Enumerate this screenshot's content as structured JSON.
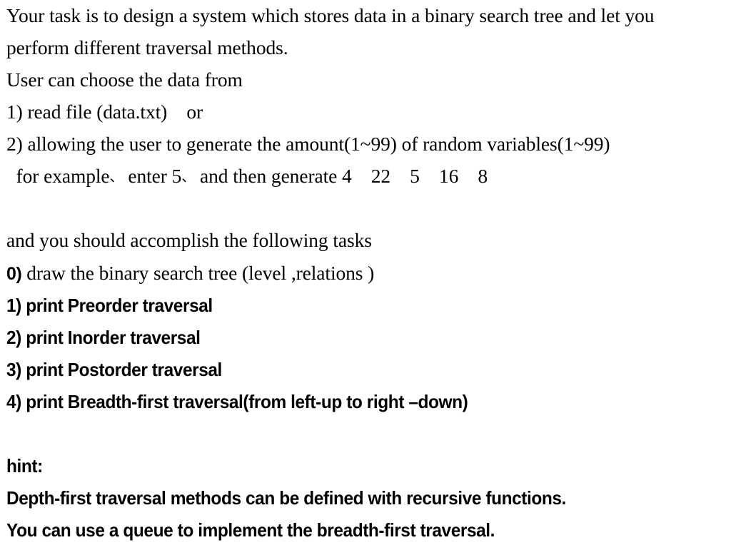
{
  "document": {
    "background_color": "#ffffff",
    "text_color": "#000000",
    "intro": {
      "line1": "Your task is to design a system which stores data in a binary search tree and let you",
      "line2": "perform different traversal methods.",
      "line3": "User can choose the data from"
    },
    "data_sources": {
      "option1": "1) read file (data.txt)    or",
      "option2": "2) allowing the user to generate the amount(1~99) of random variables(1~99)",
      "example_prefix": "  for example",
      "example_comma": "、",
      "example_mid": " enter 5",
      "example_suffix": " and then generate 4    22    5    16    8",
      "example_full": "  for example、 enter 5、 and then generate 4    22    5    16    8",
      "example_numbers": [
        4,
        22,
        5,
        16,
        8
      ]
    },
    "tasks": {
      "heading": "and you should accomplish the following tasks",
      "task0_marker": "0)",
      "task0_text": " draw the binary search tree (level ,relations )",
      "task1": "1) print Preorder traversal",
      "task2": "2) print Inorder traversal",
      "task3": "3) print Postorder traversal",
      "task4": "4) print Breadth-first traversal(from left-up to right –down)"
    },
    "hint": {
      "label": "hint:",
      "line1": "Depth-first traversal methods can be defined with recursive functions.",
      "line2": "You can use a queue to implement the breadth-first traversal."
    }
  }
}
